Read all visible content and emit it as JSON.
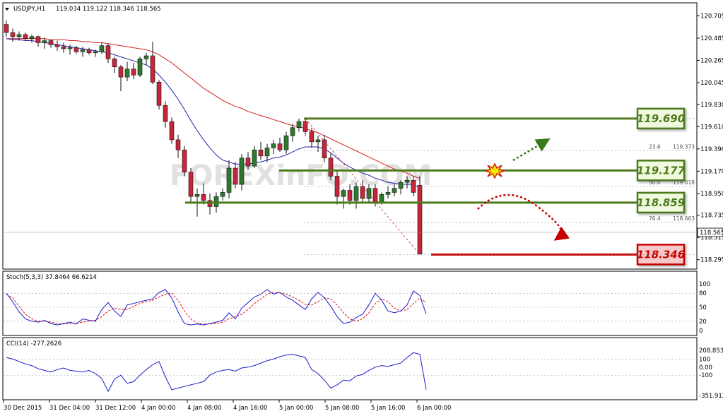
{
  "header": {
    "symbol": "USDJPY,H1",
    "ohlc": "119.034 119.122 118.346 118.565"
  },
  "watermark": "FOREXinFO.COM",
  "colors": {
    "bull": "#2d7a2d",
    "bear": "#c8243a",
    "ma_fast": "#2222aa",
    "ma_slow": "#d42020",
    "level_green": "#4a7a1a",
    "level_red": "#c40000",
    "stoch_main": "#1a1acc",
    "stoch_signal": "#dd1111",
    "cci": "#1a1acc"
  },
  "chart_data": [
    {
      "type": "candlestick",
      "title": "USDJPY,H1",
      "y_ticks": [
        "120.705",
        "120.485",
        "120.265",
        "120.045",
        "119.830",
        "119.610",
        "119.390",
        "119.170",
        "118.950",
        "118.735",
        "118.515",
        "118.295"
      ],
      "ylim": [
        118.23,
        120.75
      ],
      "current_price": "118.565",
      "x_ticks": [
        "30 Dec 2015",
        "31 Dec 04:00",
        "31 Dec 12:00",
        "4 Jan 00:00",
        "4 Jan 08:00",
        "4 Jan 16:00",
        "5 Jan 00:00",
        "5 Jan 08:00",
        "5 Jan 16:00",
        "6 Jan 00:00"
      ],
      "candles": [
        [
          120.62,
          120.66,
          120.5,
          120.54
        ],
        [
          120.54,
          120.58,
          120.45,
          120.5
        ],
        [
          120.5,
          120.55,
          120.46,
          120.52
        ],
        [
          120.52,
          120.54,
          120.46,
          120.48
        ],
        [
          120.48,
          120.52,
          120.44,
          120.5
        ],
        [
          120.5,
          120.51,
          120.4,
          120.44
        ],
        [
          120.44,
          120.49,
          120.38,
          120.46
        ],
        [
          120.46,
          120.47,
          120.39,
          120.42
        ],
        [
          120.42,
          120.46,
          120.36,
          120.4
        ],
        [
          120.4,
          120.44,
          120.34,
          120.38
        ],
        [
          120.38,
          120.42,
          120.32,
          120.39
        ],
        [
          120.39,
          120.41,
          120.33,
          120.35
        ],
        [
          120.35,
          120.4,
          120.3,
          120.37
        ],
        [
          120.37,
          120.39,
          120.32,
          120.34
        ],
        [
          120.34,
          120.37,
          120.3,
          120.35
        ],
        [
          120.35,
          120.44,
          120.33,
          120.41
        ],
        [
          120.41,
          120.43,
          120.24,
          120.28
        ],
        [
          120.28,
          120.3,
          120.14,
          120.2
        ],
        [
          120.2,
          120.22,
          119.96,
          120.1
        ],
        [
          120.1,
          120.25,
          120.06,
          120.18
        ],
        [
          120.18,
          120.24,
          120.08,
          120.12
        ],
        [
          120.12,
          120.3,
          120.1,
          120.28
        ],
        [
          120.28,
          120.34,
          120.22,
          120.31
        ],
        [
          120.31,
          120.45,
          120.03,
          120.05
        ],
        [
          120.05,
          120.07,
          119.78,
          119.82
        ],
        [
          119.82,
          119.86,
          119.6,
          119.66
        ],
        [
          119.66,
          119.7,
          119.44,
          119.48
        ],
        [
          119.48,
          119.53,
          119.3,
          119.38
        ],
        [
          119.38,
          119.42,
          119.12,
          119.16
        ],
        [
          119.16,
          119.2,
          118.85,
          118.92
        ],
        [
          118.92,
          119.0,
          118.72,
          118.94
        ],
        [
          118.94,
          119.05,
          118.84,
          118.88
        ],
        [
          118.88,
          118.95,
          118.74,
          118.82
        ],
        [
          118.82,
          118.96,
          118.76,
          118.92
        ],
        [
          118.92,
          119.0,
          118.88,
          118.96
        ],
        [
          118.96,
          119.28,
          118.9,
          119.2
        ],
        [
          119.2,
          119.26,
          119.0,
          119.04
        ],
        [
          119.04,
          119.34,
          118.98,
          119.3
        ],
        [
          119.3,
          119.36,
          119.18,
          119.22
        ],
        [
          119.22,
          119.42,
          119.2,
          119.38
        ],
        [
          119.38,
          119.46,
          119.28,
          119.32
        ],
        [
          119.32,
          119.44,
          119.26,
          119.4
        ],
        [
          119.4,
          119.48,
          119.34,
          119.44
        ],
        [
          119.44,
          119.5,
          119.36,
          119.38
        ],
        [
          119.38,
          119.56,
          119.34,
          119.52
        ],
        [
          119.52,
          119.64,
          119.46,
          119.6
        ],
        [
          119.6,
          119.69,
          119.56,
          119.66
        ],
        [
          119.66,
          119.68,
          119.52,
          119.56
        ],
        [
          119.56,
          119.6,
          119.4,
          119.46
        ],
        [
          119.46,
          119.52,
          119.36,
          119.48
        ],
        [
          119.48,
          119.53,
          119.26,
          119.3
        ],
        [
          119.3,
          119.35,
          119.08,
          119.12
        ],
        [
          119.12,
          119.18,
          118.84,
          118.92
        ],
        [
          118.92,
          119.0,
          118.8,
          118.98
        ],
        [
          118.98,
          119.04,
          118.84,
          118.88
        ],
        [
          118.88,
          119.06,
          118.8,
          119.02
        ],
        [
          119.02,
          119.08,
          118.86,
          118.9
        ],
        [
          118.9,
          119.04,
          118.86,
          119.0
        ],
        [
          119.0,
          119.04,
          118.82,
          118.86
        ],
        [
          118.86,
          118.96,
          118.84,
          118.94
        ],
        [
          118.94,
          119.02,
          118.9,
          118.96
        ],
        [
          118.96,
          119.04,
          118.92,
          119.0
        ],
        [
          119.0,
          119.08,
          118.94,
          119.06
        ],
        [
          119.06,
          119.12,
          119.0,
          119.08
        ],
        [
          119.08,
          119.12,
          118.92,
          118.96
        ],
        [
          119.03,
          119.12,
          118.35,
          118.35
        ]
      ],
      "ma_fast_name": "",
      "ma_fast": [
        120.48,
        120.47,
        120.47,
        120.46,
        120.46,
        120.45,
        120.44,
        120.43,
        120.42,
        120.41,
        120.4,
        120.39,
        120.38,
        120.37,
        120.36,
        120.35,
        120.34,
        120.32,
        120.3,
        120.28,
        120.26,
        120.24,
        120.22,
        120.18,
        120.12,
        120.05,
        119.97,
        119.88,
        119.78,
        119.67,
        119.57,
        119.48,
        119.4,
        119.33,
        119.28,
        119.26,
        119.24,
        119.24,
        119.24,
        119.25,
        119.26,
        119.28,
        119.3,
        119.31,
        119.33,
        119.36,
        119.39,
        119.41,
        119.41,
        119.41,
        119.39,
        119.35,
        119.3,
        119.25,
        119.21,
        119.18,
        119.15,
        119.13,
        119.1,
        119.08,
        119.06,
        119.05,
        119.04,
        119.04,
        119.04,
        119.0
      ],
      "ma_slow_name": "",
      "ma_slow": [
        120.48,
        120.48,
        120.48,
        120.48,
        120.48,
        120.48,
        120.48,
        120.47,
        120.47,
        120.47,
        120.46,
        120.46,
        120.45,
        120.45,
        120.44,
        120.44,
        120.43,
        120.42,
        120.41,
        120.4,
        120.39,
        120.38,
        120.37,
        120.35,
        120.32,
        120.28,
        120.24,
        120.19,
        120.14,
        120.09,
        120.04,
        119.99,
        119.95,
        119.91,
        119.87,
        119.84,
        119.81,
        119.79,
        119.76,
        119.74,
        119.72,
        119.7,
        119.68,
        119.66,
        119.64,
        119.62,
        119.61,
        119.59,
        119.57,
        119.55,
        119.52,
        119.49,
        119.46,
        119.43,
        119.4,
        119.37,
        119.34,
        119.31,
        119.28,
        119.25,
        119.22,
        119.19,
        119.17,
        119.15,
        119.12,
        119.1
      ],
      "levels": [
        {
          "label": "119.690",
          "value": 119.69,
          "color": "green"
        },
        {
          "label": "119.177",
          "value": 119.177,
          "color": "green"
        },
        {
          "label": "118.859",
          "value": 118.859,
          "color": "green"
        },
        {
          "label": "118.346",
          "value": 118.346,
          "color": "red"
        }
      ],
      "fib_levels": [
        {
          "ratio": "23.6",
          "price": "119.373",
          "value": 119.373
        },
        {
          "ratio": "50.0",
          "price": "119.018",
          "value": 119.018
        },
        {
          "ratio": "76.4",
          "price": "118.663",
          "value": 118.663
        }
      ]
    },
    {
      "type": "line",
      "title": "Stoch(5,3,3) 37.8464 66.6214",
      "y_ticks": [
        "100",
        "80",
        "50",
        "20",
        "0"
      ],
      "ylim": [
        0,
        100
      ],
      "main_name": "",
      "main": [
        80,
        62,
        40,
        25,
        20,
        18,
        22,
        15,
        12,
        15,
        18,
        14,
        25,
        22,
        20,
        45,
        60,
        42,
        30,
        55,
        58,
        62,
        65,
        68,
        82,
        88,
        70,
        40,
        15,
        12,
        14,
        12,
        15,
        18,
        22,
        38,
        25,
        48,
        60,
        72,
        78,
        88,
        78,
        82,
        72,
        65,
        55,
        45,
        68,
        82,
        70,
        52,
        30,
        15,
        18,
        28,
        35,
        55,
        80,
        65,
        42,
        38,
        42,
        55,
        85,
        75,
        35
      ],
      "signal_name": "",
      "signal": [
        78,
        70,
        52,
        35,
        25,
        20,
        20,
        18,
        15,
        14,
        15,
        16,
        18,
        20,
        22,
        30,
        42,
        48,
        45,
        45,
        52,
        58,
        62,
        65,
        72,
        78,
        80,
        65,
        42,
        25,
        16,
        14,
        14,
        15,
        18,
        25,
        30,
        35,
        45,
        58,
        68,
        78,
        82,
        82,
        78,
        72,
        65,
        56,
        55,
        62,
        70,
        68,
        55,
        38,
        25,
        20,
        25,
        38,
        58,
        68,
        62,
        48,
        42,
        45,
        58,
        70,
        60
      ]
    },
    {
      "type": "line",
      "title": "CCI(14) -277.2626",
      "y_ticks": [
        "208.8533",
        "100",
        "0.00",
        "-100",
        "-351.9122"
      ],
      "ylim": [
        -351.9122,
        208.8533
      ],
      "cci_name": "",
      "cci": [
        120,
        100,
        70,
        40,
        20,
        -20,
        -40,
        -60,
        -30,
        -10,
        -40,
        -50,
        -60,
        -40,
        -80,
        -140,
        -300,
        -150,
        -100,
        -200,
        -180,
        -100,
        -30,
        30,
        70,
        -120,
        -280,
        -260,
        -240,
        -220,
        -200,
        -180,
        -100,
        -60,
        -40,
        -30,
        -50,
        -10,
        0,
        20,
        50,
        80,
        100,
        130,
        150,
        160,
        140,
        120,
        -30,
        -80,
        -160,
        -260,
        -220,
        -160,
        -170,
        -110,
        -90,
        -40,
        0,
        20,
        10,
        30,
        50,
        120,
        180,
        160,
        -277
      ]
    }
  ]
}
